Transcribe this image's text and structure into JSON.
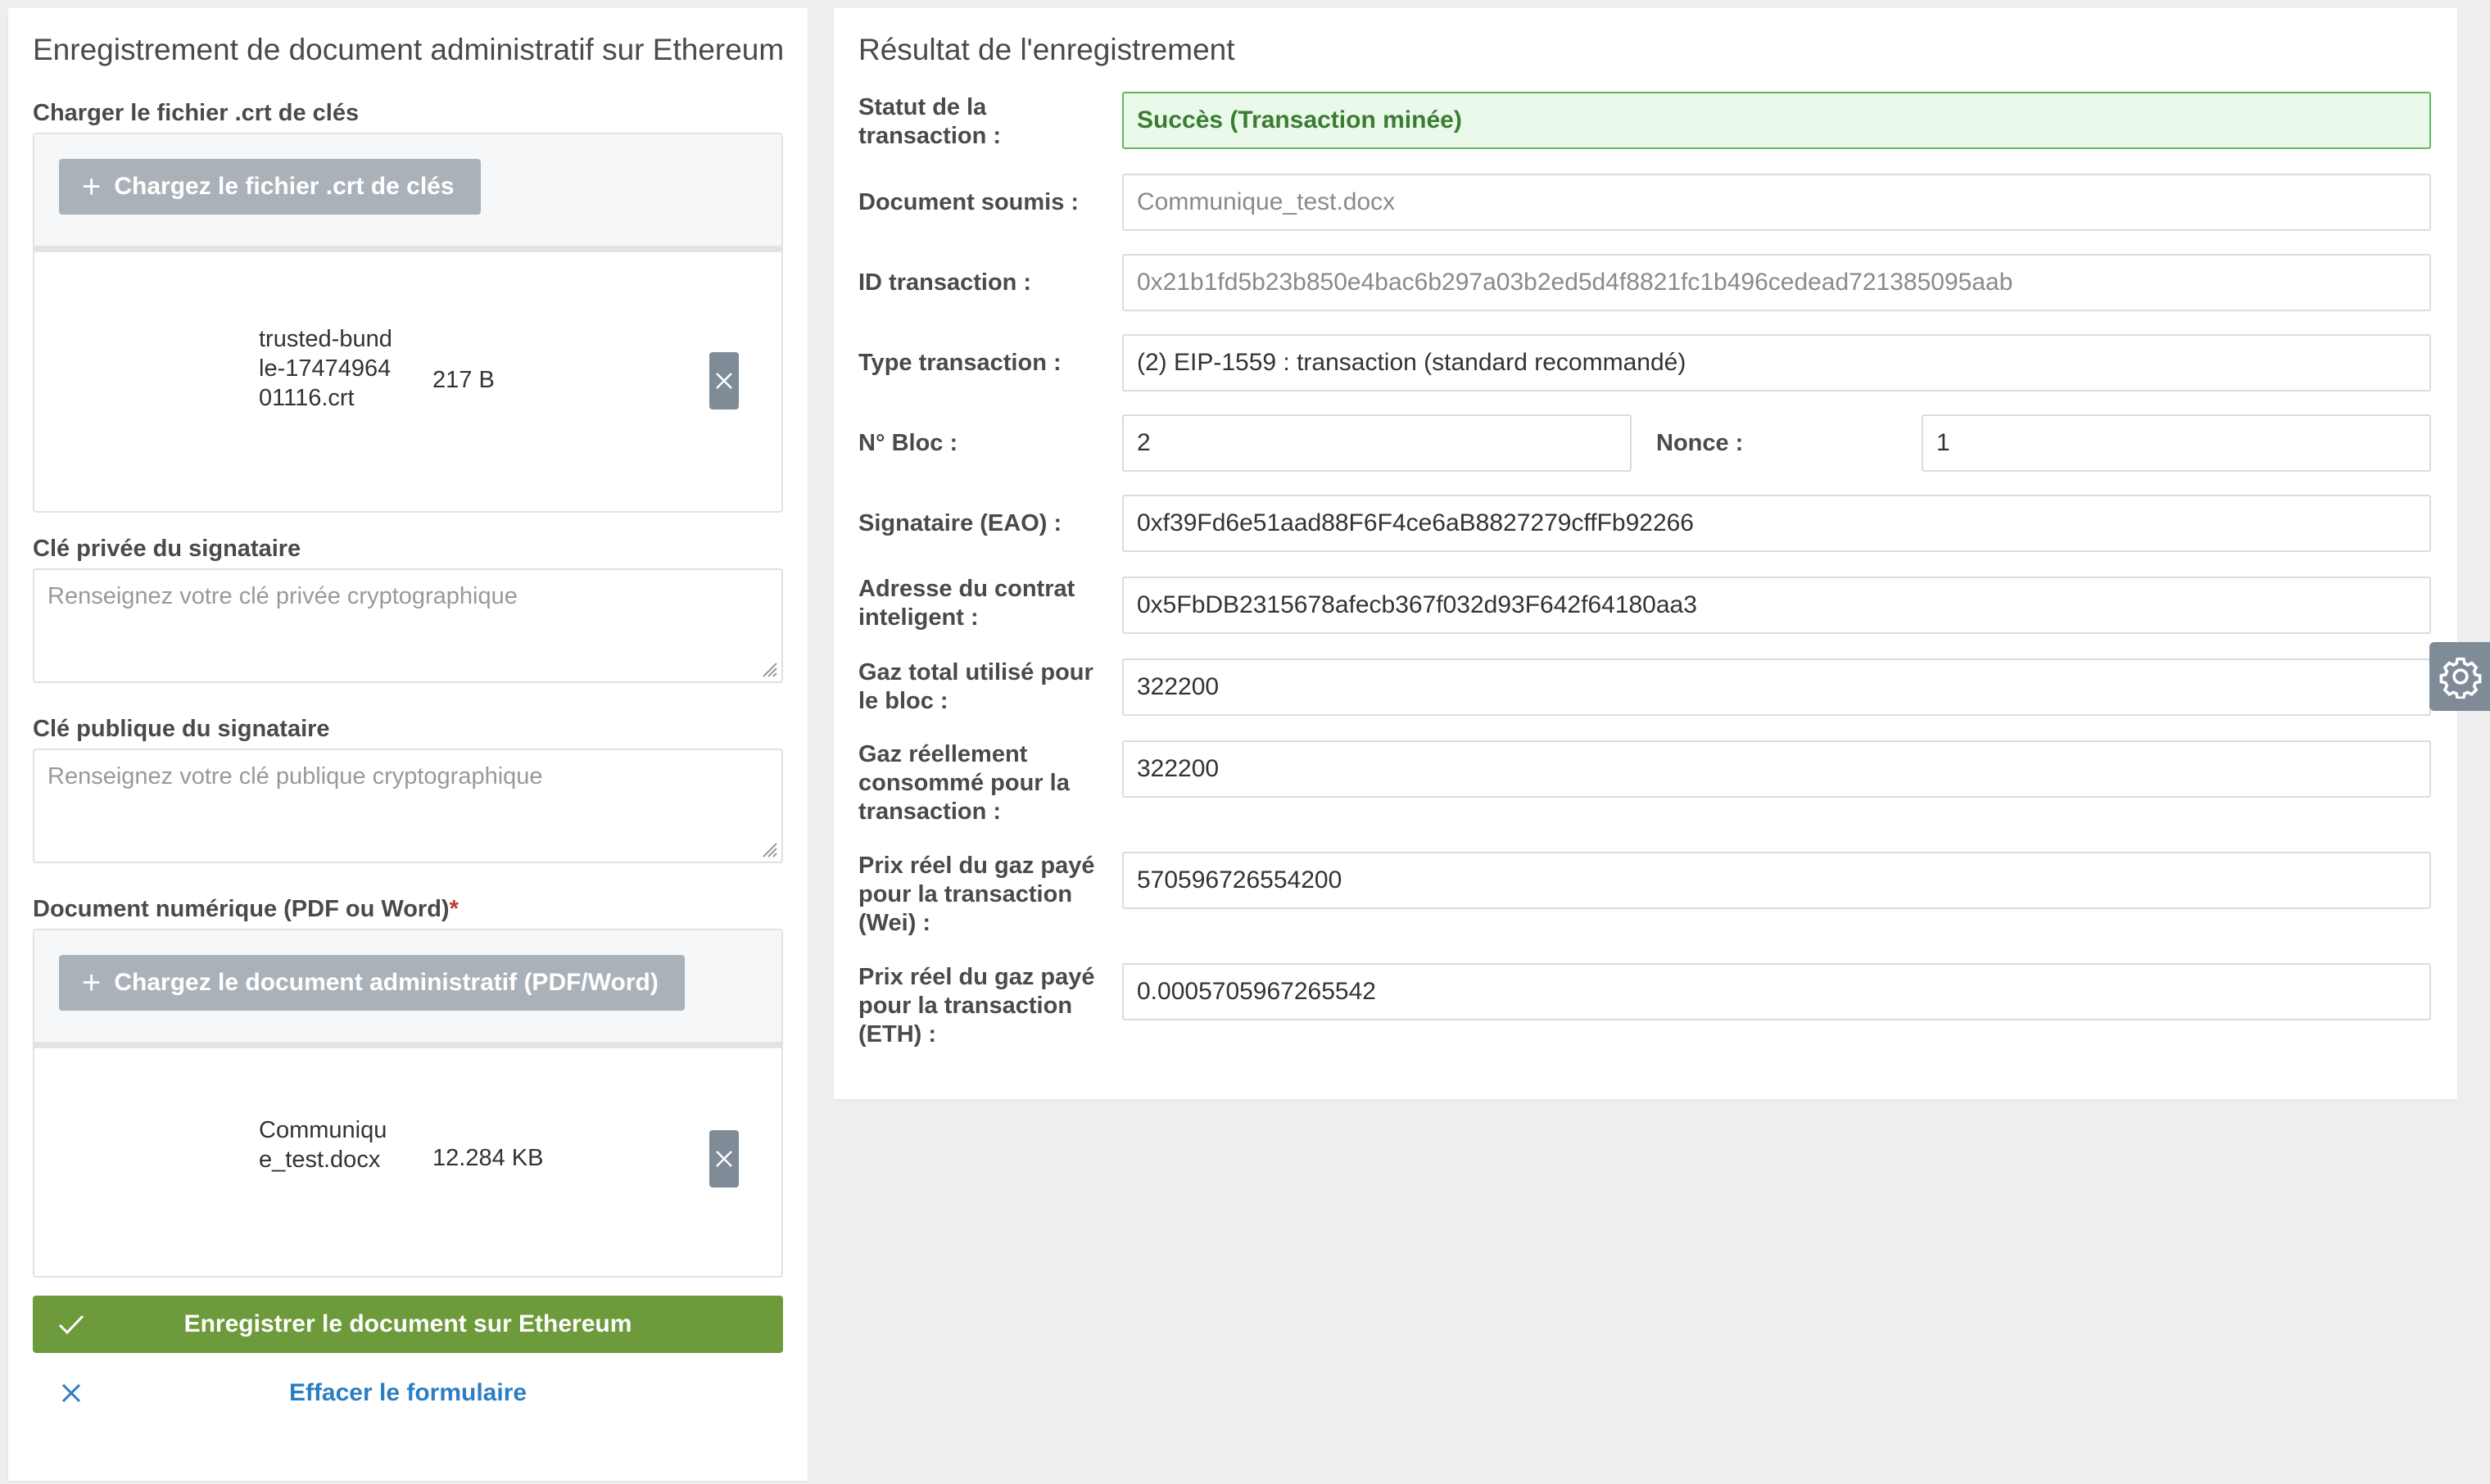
{
  "left": {
    "title": "Enregistrement de document administratif sur Ethereum",
    "keys_file": {
      "label": "Charger le fichier .crt de clés",
      "button": "Chargez le fichier .crt de clés",
      "file_name": "trusted-bundle-1747496401116.crt",
      "file_size": "217 B"
    },
    "private_key": {
      "label": "Clé privée du signataire",
      "placeholder": "Renseignez votre clé privée cryptographique"
    },
    "public_key": {
      "label": "Clé publique du signataire",
      "placeholder": "Renseignez votre clé publique cryptographique"
    },
    "document": {
      "label": "Document numérique (PDF ou Word)",
      "required_mark": "*",
      "button": "Chargez le document administratif (PDF/Word)",
      "file_name": "Communique_test.docx",
      "file_size": "12.284 KB"
    },
    "submit_label": "Enregistrer le document sur Ethereum",
    "clear_label": "Effacer le formulaire"
  },
  "right": {
    "title": "Résultat de l'enregistrement",
    "status_label": "Statut de la transaction :",
    "status_value": "Succès (Transaction minée)",
    "document_label": "Document soumis :",
    "document_value": "Communique_test.docx",
    "tx_id_label": "ID transaction :",
    "tx_id_value": "0x21b1fd5b23b850e4bac6b297a03b2ed5d4f8821fc1b496cedead721385095aab",
    "tx_type_label": "Type transaction :",
    "tx_type_value": "(2) EIP-1559 : transaction (standard recommandé)",
    "block_label": "N° Bloc :",
    "block_value": "2",
    "nonce_label": "Nonce :",
    "nonce_value": "1",
    "signer_label": "Signataire (EAO) :",
    "signer_value": "0xf39Fd6e51aad88F6F4ce6aB8827279cffFb92266",
    "contract_label": "Adresse du contrat inteligent :",
    "contract_value": "0x5FbDB2315678afecb367f032d93F642f64180aa3",
    "gas_total_label": "Gaz total utilisé pour le bloc :",
    "gas_total_value": "322200",
    "gas_used_label": "Gaz réellement consommé pour la transaction :",
    "gas_used_value": "322200",
    "price_wei_label": "Prix réel du gaz payé pour la transaction (Wei) :",
    "price_wei_value": "570596726554200",
    "price_eth_label": "Prix réel du gaz payé pour la transaction (ETH) :",
    "price_eth_value": "0.0005705967265542"
  },
  "icons": {
    "plus": "plus-icon",
    "remove": "close-icon",
    "check": "check-icon",
    "clear": "close-icon",
    "settings": "gear-icon"
  },
  "colors": {
    "submit": "#6d9a3a",
    "success_bg": "#eaf9ea",
    "success_border": "#5fb85f",
    "link": "#2b7ec2",
    "upload_button": "#aab2b9"
  }
}
